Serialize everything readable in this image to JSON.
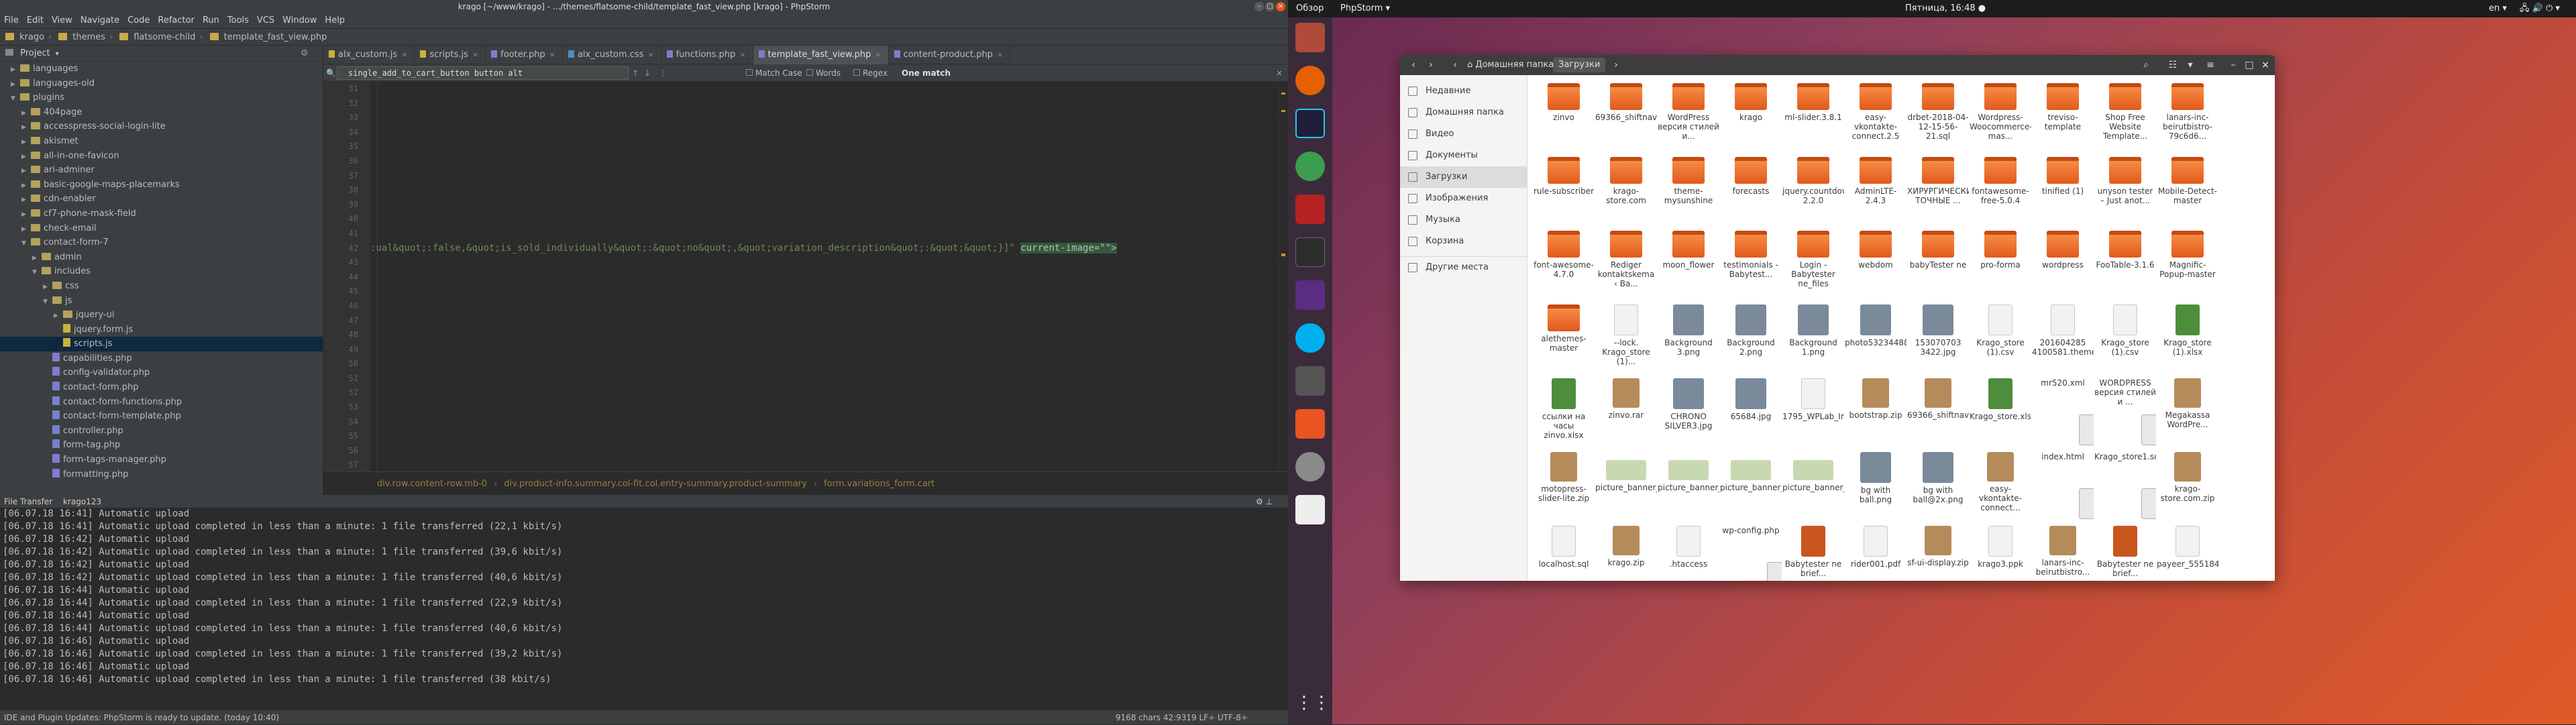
{
  "ide": {
    "title": "krago [~/www/krago] - .../themes/flatsome-child/template_fast_view.php [krago] - PhpStorm",
    "menu": [
      "File",
      "Edit",
      "View",
      "Navigate",
      "Code",
      "Refactor",
      "Run",
      "Tools",
      "VCS",
      "Window",
      "Help"
    ],
    "breadcrumbs": [
      "krago",
      "themes",
      "flatsome-child",
      "template_fast_view.php"
    ],
    "project_label": "Project",
    "tree": [
      {
        "label": "languages",
        "indent": 1,
        "type": "folder",
        "open": false
      },
      {
        "label": "languages-old",
        "indent": 1,
        "type": "folder",
        "open": false
      },
      {
        "label": "plugins",
        "indent": 1,
        "type": "folder",
        "open": true
      },
      {
        "label": "404page",
        "indent": 2,
        "type": "folder",
        "open": false
      },
      {
        "label": "accesspress-social-login-lite",
        "indent": 2,
        "type": "folder",
        "open": false
      },
      {
        "label": "akismet",
        "indent": 2,
        "type": "folder",
        "open": false
      },
      {
        "label": "all-in-one-favicon",
        "indent": 2,
        "type": "folder",
        "open": false
      },
      {
        "label": "ari-adminer",
        "indent": 2,
        "type": "folder",
        "open": false
      },
      {
        "label": "basic-google-maps-placemarks",
        "indent": 2,
        "type": "folder",
        "open": false
      },
      {
        "label": "cdn-enabler",
        "indent": 2,
        "type": "folder",
        "open": false
      },
      {
        "label": "cf7-phone-mask-field",
        "indent": 2,
        "type": "folder",
        "open": false
      },
      {
        "label": "check-email",
        "indent": 2,
        "type": "folder",
        "open": false
      },
      {
        "label": "contact-form-7",
        "indent": 2,
        "type": "folder",
        "open": true
      },
      {
        "label": "admin",
        "indent": 3,
        "type": "folder",
        "open": false
      },
      {
        "label": "includes",
        "indent": 3,
        "type": "folder",
        "open": true
      },
      {
        "label": "css",
        "indent": 4,
        "type": "folder",
        "open": false
      },
      {
        "label": "js",
        "indent": 4,
        "type": "folder",
        "open": true
      },
      {
        "label": "jquery-ui",
        "indent": 5,
        "type": "folder",
        "open": false
      },
      {
        "label": "jquery.form.js",
        "indent": 5,
        "type": "js",
        "open": false
      },
      {
        "label": "scripts.js",
        "indent": 5,
        "type": "js",
        "open": false,
        "selected": true
      },
      {
        "label": "capabilities.php",
        "indent": 4,
        "type": "php"
      },
      {
        "label": "config-validator.php",
        "indent": 4,
        "type": "php"
      },
      {
        "label": "contact-form.php",
        "indent": 4,
        "type": "php"
      },
      {
        "label": "contact-form-functions.php",
        "indent": 4,
        "type": "php"
      },
      {
        "label": "contact-form-template.php",
        "indent": 4,
        "type": "php"
      },
      {
        "label": "controller.php",
        "indent": 4,
        "type": "php"
      },
      {
        "label": "form-tag.php",
        "indent": 4,
        "type": "php"
      },
      {
        "label": "form-tags-manager.php",
        "indent": 4,
        "type": "php"
      },
      {
        "label": "formatting.php",
        "indent": 4,
        "type": "php"
      }
    ],
    "tabs": [
      {
        "label": "alx_custom.js",
        "active": false
      },
      {
        "label": "scripts.js",
        "active": false
      },
      {
        "label": "footer.php",
        "active": false
      },
      {
        "label": "alx_custom.css",
        "active": false
      },
      {
        "label": "functions.php",
        "active": false
      },
      {
        "label": "template_fast_view.php",
        "active": true
      },
      {
        "label": "content-product.php",
        "active": false
      }
    ],
    "find": {
      "query": "single_add_to_cart_button button alt",
      "match_case": "Match Case",
      "words": "Words",
      "regex": "Regex",
      "result": "One match"
    },
    "line_numbers": [
      "31",
      "32",
      "33",
      "34",
      "35",
      "36",
      "37",
      "38",
      "39",
      "40",
      "41",
      "42",
      "43",
      "44",
      "45",
      "46",
      "47",
      "48",
      "49",
      "50",
      "51",
      "52",
      "53",
      "54",
      "55",
      "56",
      "57",
      "58",
      "59"
    ],
    "code_line_42": ":ual&quot;:false,&quot;is_sold_individually&quot;:&quot;no&quot;,&quot;variation_description&quot;:&quot;&quot;}]\" ",
    "code_line_42_attr": "current-image=\"\">",
    "editor_breadcrumb": [
      "div.row.content-row.mb-0",
      "div.product-info.summary.col-fit.col.entry-summary.product-summary",
      "form.variations_form.cart"
    ],
    "file_transfer": {
      "label": "File Transfer",
      "tab": "krago123"
    },
    "log": [
      "[06.07.18 16:41] Automatic upload",
      "[06.07.18 16:41] Automatic upload completed in less than a minute: 1 file transferred (22,1 kbit/s)",
      "[06.07.18 16:42] Automatic upload",
      "[06.07.18 16:42] Automatic upload completed in less than a minute: 1 file transferred (39,6 kbit/s)",
      "[06.07.18 16:42] Automatic upload",
      "[06.07.18 16:42] Automatic upload completed in less than a minute: 1 file transferred (40,6 kbit/s)",
      "[06.07.18 16:44] Automatic upload",
      "[06.07.18 16:44] Automatic upload completed in less than a minute: 1 file transferred (22,9 kbit/s)",
      "[06.07.18 16:44] Automatic upload",
      "[06.07.18 16:44] Automatic upload completed in less than a minute: 1 file transferred (40,6 kbit/s)",
      "[06.07.18 16:46] Automatic upload",
      "[06.07.18 16:46] Automatic upload completed in less than a minute: 1 file transferred (39,2 kbit/s)",
      "[06.07.18 16:46] Automatic upload",
      "[06.07.18 16:46] Automatic upload completed in less than a minute: 1 file transferred (38 kbit/s)"
    ],
    "status_left": "IDE and Plugin Updates: PhpStorm is ready to update. (today 10:40)",
    "status_right": "9168 chars   42:9319   LF÷   UTF-8÷"
  },
  "topbar": {
    "overview": "Обзор",
    "app": "PhpStorm ▾",
    "clock": "Пятница, 16:48 ●",
    "lang": "en ▾"
  },
  "filemanager": {
    "crumbs": [
      "Домашняя папка",
      "Загрузки"
    ],
    "sidebar": [
      "Недавние",
      "Домашняя папка",
      "Видео",
      "Документы",
      "Загрузки",
      "Изображения",
      "Музыка",
      "Корзина",
      "Другие места"
    ],
    "files": [
      {
        "name": "zinvo",
        "kind": "folder"
      },
      {
        "name": "69366_shiftnavpro162",
        "kind": "folder"
      },
      {
        "name": "WordPress версия стилей и...",
        "kind": "folder"
      },
      {
        "name": "krago",
        "kind": "folder"
      },
      {
        "name": "ml-slider.3.8.1",
        "kind": "folder"
      },
      {
        "name": "easy-vkontakte-connect.2.5",
        "kind": "folder"
      },
      {
        "name": "drbet-2018-04-12-15-56-21.sql",
        "kind": "folder"
      },
      {
        "name": "Wordpress-Woocommerce-mas...",
        "kind": "folder"
      },
      {
        "name": "treviso-template",
        "kind": "folder"
      },
      {
        "name": "Shop Free Website Template...",
        "kind": "folder"
      },
      {
        "name": "lanars-inc-beirutbistro-79c6d6...",
        "kind": "folder"
      },
      {
        "name": "rule-subscriber",
        "kind": "folder"
      },
      {
        "name": "krago-store.com",
        "kind": "folder"
      },
      {
        "name": "theme-mysunshine",
        "kind": "folder"
      },
      {
        "name": "forecasts",
        "kind": "folder"
      },
      {
        "name": "jquery.countdown-2.2.0",
        "kind": "folder"
      },
      {
        "name": "AdminLTE-2.4.3",
        "kind": "folder"
      },
      {
        "name": "ХИРУРГИЧЕСКИ ТОЧНЫЕ ...",
        "kind": "folder"
      },
      {
        "name": "fontawesome-free-5.0.4",
        "kind": "folder"
      },
      {
        "name": "tinified (1)",
        "kind": "folder"
      },
      {
        "name": "unyson tester – Just anot...",
        "kind": "folder"
      },
      {
        "name": "Mobile-Detect-master",
        "kind": "folder"
      },
      {
        "name": "font-awesome-4.7.0",
        "kind": "folder"
      },
      {
        "name": "Rediger kontaktskema ‹ Ba...",
        "kind": "folder"
      },
      {
        "name": "moon_flower",
        "kind": "folder"
      },
      {
        "name": "testimonials - Babytest...",
        "kind": "folder"
      },
      {
        "name": "Login - Babytester ne_files",
        "kind": "folder"
      },
      {
        "name": "webdom",
        "kind": "folder"
      },
      {
        "name": "babyTester ne",
        "kind": "folder"
      },
      {
        "name": "pro-forma",
        "kind": "folder"
      },
      {
        "name": "wordpress",
        "kind": "folder"
      },
      {
        "name": "FooTable-3.1.6",
        "kind": "folder"
      },
      {
        "name": "Magnific-Popup-master",
        "kind": "folder"
      },
      {
        "name": "alethemes-master",
        "kind": "folder"
      },
      {
        "name": "--lock. Krago_store (1)...",
        "kind": "doc"
      },
      {
        "name": "Background 3.png",
        "kind": "img"
      },
      {
        "name": "Background 2.png",
        "kind": "img"
      },
      {
        "name": "Background 1.png",
        "kind": "img"
      },
      {
        "name": "photo5323448866760141531.jpg",
        "kind": "img"
      },
      {
        "name": "153070703 3422.jpg",
        "kind": "img"
      },
      {
        "name": "Krago_store (1).csv",
        "kind": "doc"
      },
      {
        "name": "201604285 4100581.theme",
        "kind": "doc"
      },
      {
        "name": "Krago_store (1).csv",
        "kind": "doc"
      },
      {
        "name": "Krago_store (1).xlsx",
        "kind": "xls"
      },
      {
        "name": "ссылки на часы zinvo.xlsx",
        "kind": "xls"
      },
      {
        "name": "zinvo.rar",
        "kind": "zip"
      },
      {
        "name": "CHRONO SILVER3.jpg",
        "kind": "img"
      },
      {
        "name": "65684.jpg",
        "kind": "img"
      },
      {
        "name": "1795_WPLab_Import15...",
        "kind": "doc"
      },
      {
        "name": "bootstrap.zip",
        "kind": "zip"
      },
      {
        "name": "69366_shiftnavpro162.zip",
        "kind": "zip"
      },
      {
        "name": "Krago_store.xlsx",
        "kind": "xls"
      },
      {
        "name": "mr520.xml",
        "kind": "code"
      },
      {
        "name": "WORDPRESS версия стилей и ...",
        "kind": "code"
      },
      {
        "name": "Megakassa WordPre...",
        "kind": "zip"
      },
      {
        "name": "motopress-slider-lite.zip",
        "kind": "zip"
      },
      {
        "name": "picture_banner_football_...",
        "kind": "banner"
      },
      {
        "name": "picture_banner_football_...",
        "kind": "banner"
      },
      {
        "name": "picture_banner_football_...",
        "kind": "banner"
      },
      {
        "name": "picture_banner_football_...",
        "kind": "banner"
      },
      {
        "name": "bg with ball.png",
        "kind": "img"
      },
      {
        "name": "bg with ball@2x.png",
        "kind": "img"
      },
      {
        "name": "easy-vkontakte-connect...",
        "kind": "zip"
      },
      {
        "name": "index.html",
        "kind": "code"
      },
      {
        "name": "Krago_store1.sql",
        "kind": "code"
      },
      {
        "name": "krago-store.com.zip",
        "kind": "zip"
      },
      {
        "name": "localhost.sql",
        "kind": "doc"
      },
      {
        "name": "krago.zip",
        "kind": "zip"
      },
      {
        "name": ".htaccess",
        "kind": "doc"
      },
      {
        "name": "wp-config.php",
        "kind": "code"
      },
      {
        "name": "Babytester ne brief...",
        "kind": "pdf"
      },
      {
        "name": "rider001.pdf",
        "kind": "doc"
      },
      {
        "name": "sf-ui-display.zip",
        "kind": "zip"
      },
      {
        "name": "krago3.ppk",
        "kind": "doc"
      },
      {
        "name": "lanars-inc-beirutbistro...",
        "kind": "zip"
      },
      {
        "name": "Babytester ne brief...",
        "kind": "pdf"
      },
      {
        "name": "payeer_555184006...",
        "kind": "doc"
      }
    ]
  },
  "colors": {
    "accent": "#e95420",
    "folder": "#e2591b",
    "ide_bg": "#2b2b2b",
    "panel": "#3c3f41",
    "search_hl": "#32593d"
  }
}
